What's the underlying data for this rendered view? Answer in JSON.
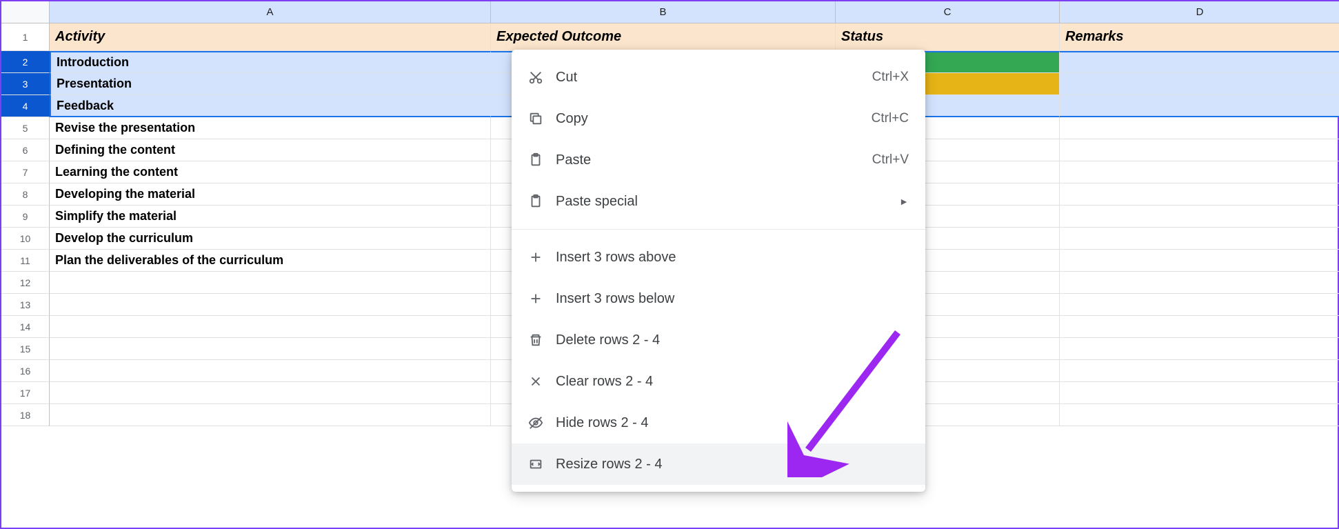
{
  "columns": [
    "A",
    "B",
    "C",
    "D"
  ],
  "headers": {
    "A": "Activity",
    "B": "Expected Outcome",
    "C": "Status",
    "D": "Remarks"
  },
  "rows": [
    {
      "n": "1"
    },
    {
      "n": "2",
      "activity": "Introduction",
      "selected": true,
      "status_color": "green"
    },
    {
      "n": "3",
      "activity": "Presentation",
      "selected": true,
      "status_color": "yellow"
    },
    {
      "n": "4",
      "activity": "Feedback",
      "selected": true
    },
    {
      "n": "5",
      "activity": "Revise the presentation"
    },
    {
      "n": "6",
      "activity": "Defining the content"
    },
    {
      "n": "7",
      "activity": "Learning the content"
    },
    {
      "n": "8",
      "activity": "Developing the material"
    },
    {
      "n": "9",
      "activity": "Simplify the material"
    },
    {
      "n": "10",
      "activity": "Develop the curriculum"
    },
    {
      "n": "11",
      "activity": "Plan the deliverables of the curriculum"
    },
    {
      "n": "12"
    },
    {
      "n": "13"
    },
    {
      "n": "14"
    },
    {
      "n": "15"
    },
    {
      "n": "16"
    },
    {
      "n": "17"
    },
    {
      "n": "18"
    }
  ],
  "context_menu": {
    "cut": "Cut",
    "cut_shortcut": "Ctrl+X",
    "copy": "Copy",
    "copy_shortcut": "Ctrl+C",
    "paste": "Paste",
    "paste_shortcut": "Ctrl+V",
    "paste_special": "Paste special",
    "insert_above": "Insert 3 rows above",
    "insert_below": "Insert 3 rows below",
    "delete_rows": "Delete rows 2 - 4",
    "clear_rows": "Clear rows 2 - 4",
    "hide_rows": "Hide rows 2 - 4",
    "resize_rows": "Resize rows 2 - 4"
  }
}
